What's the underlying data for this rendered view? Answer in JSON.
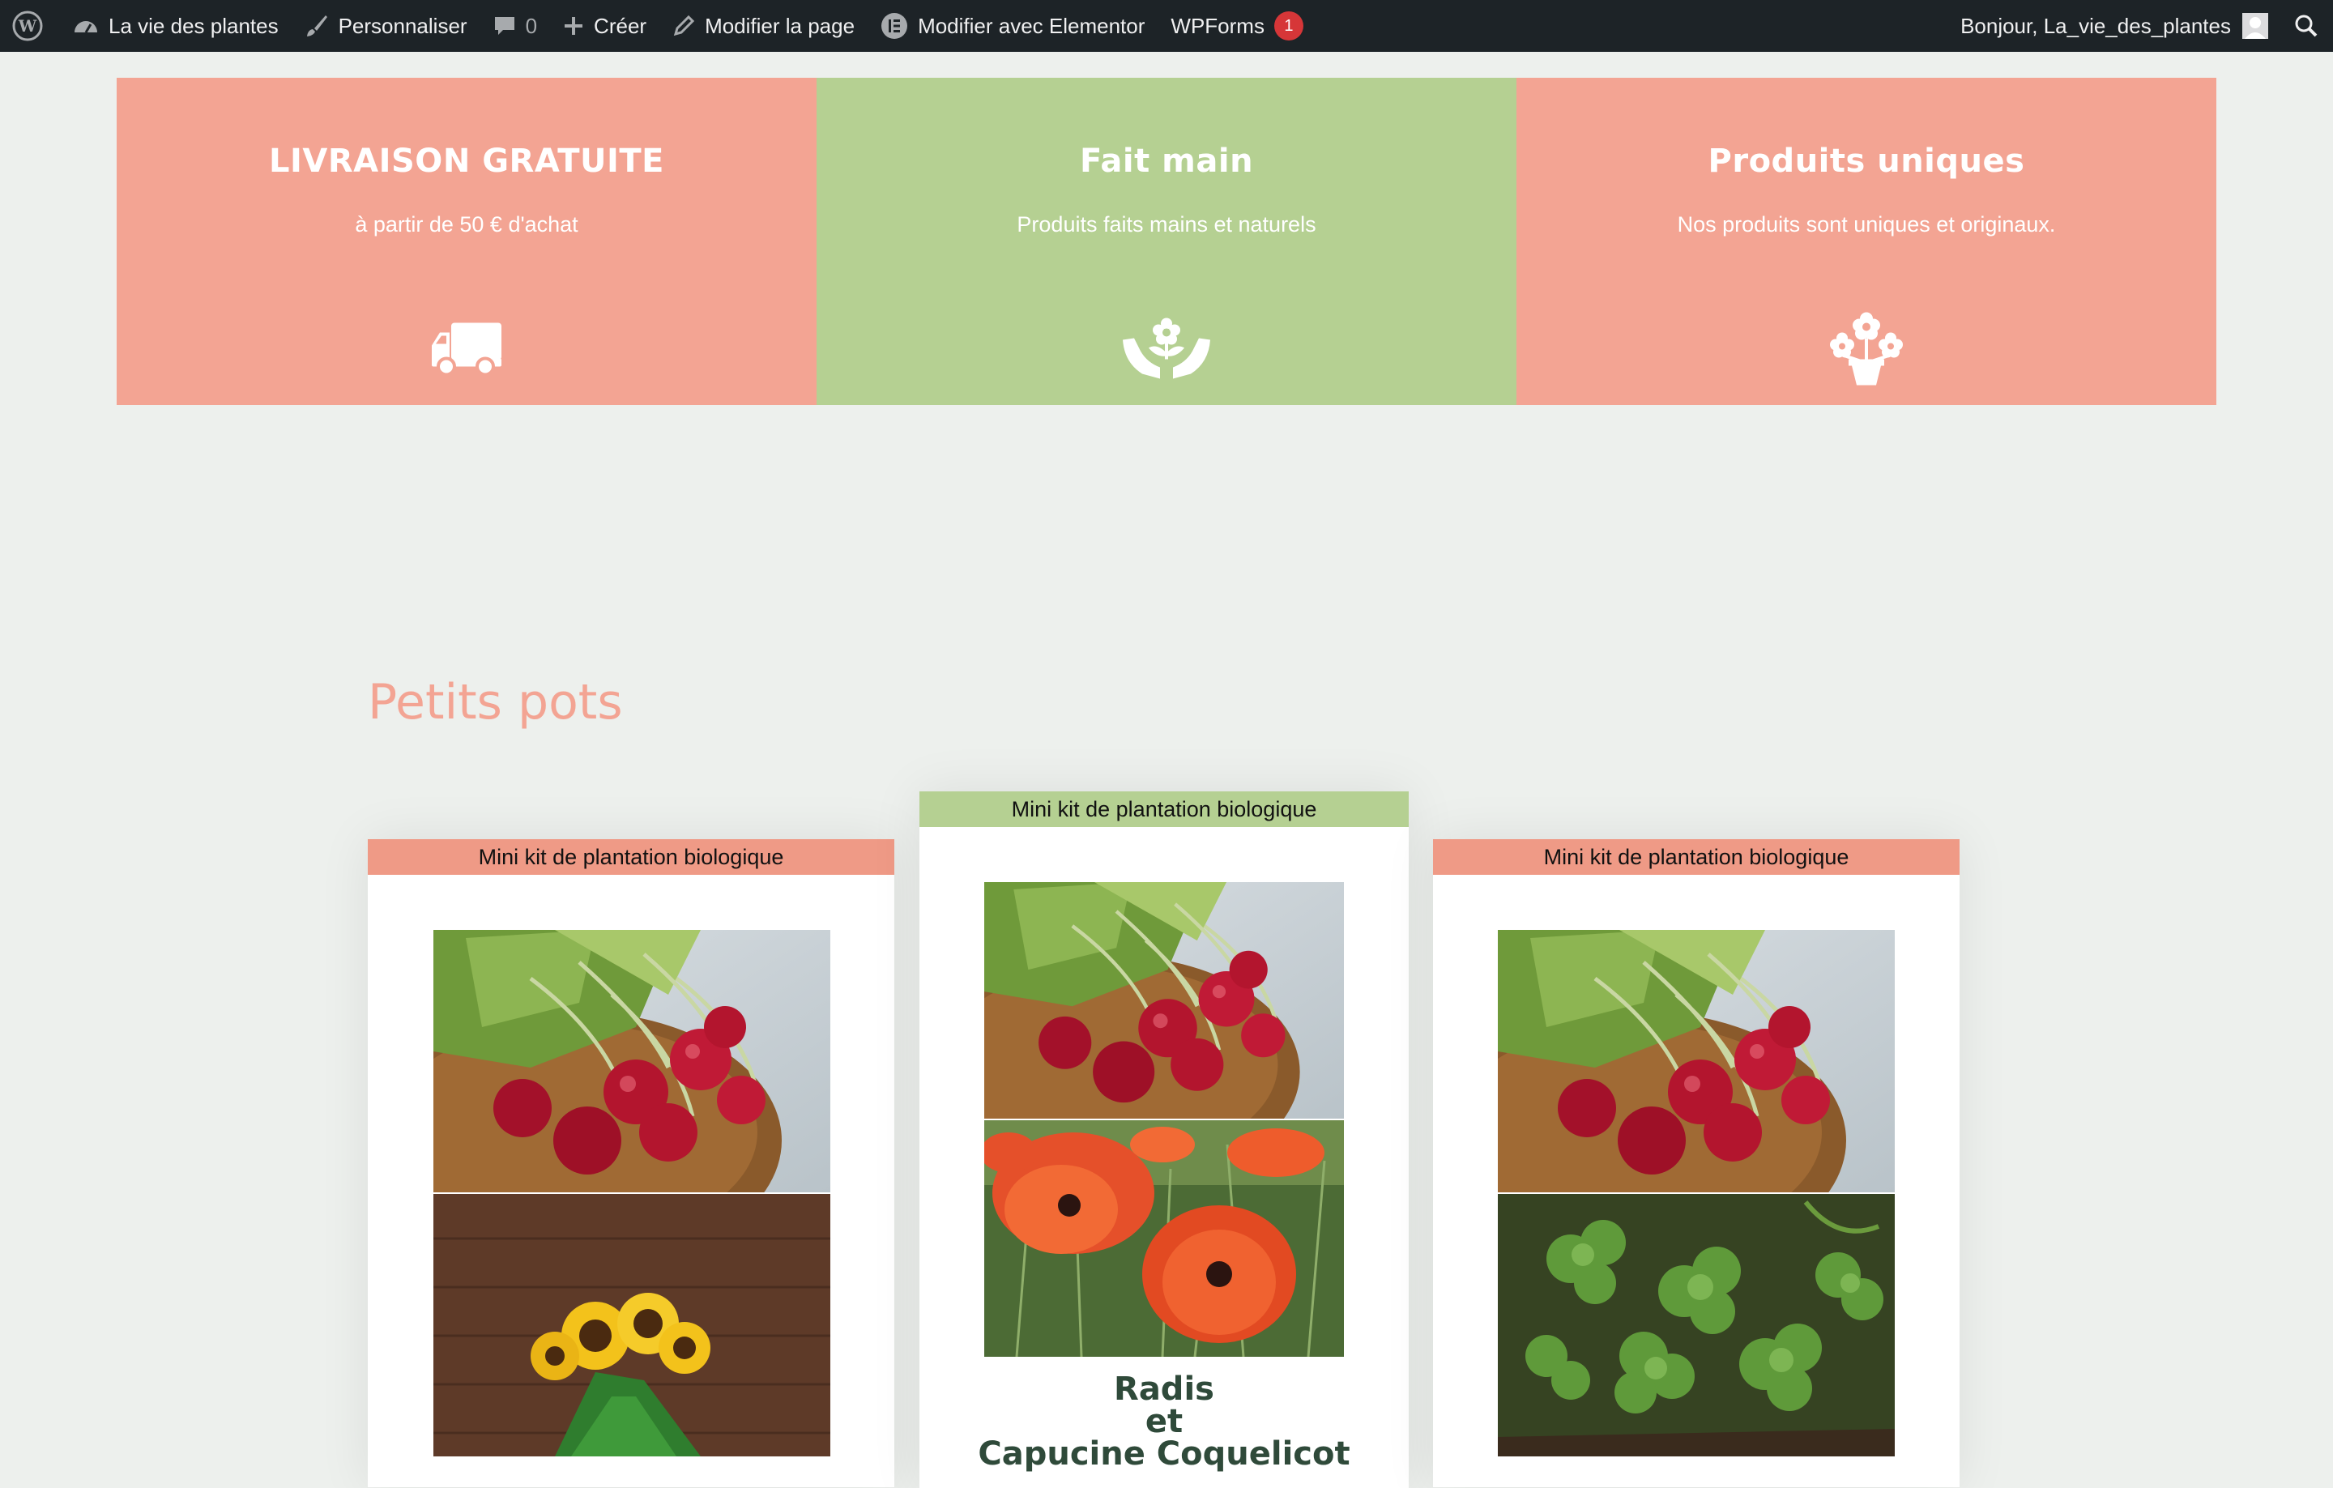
{
  "adminbar": {
    "site_name": "La vie des plantes",
    "customize": "Personnaliser",
    "comments_count": "0",
    "new": "Créer",
    "edit_page": "Modifier la page",
    "elementor": "Modifier avec Elementor",
    "wpforms": "WPForms",
    "wpforms_badge": "1",
    "greeting": "Bonjour, La_vie_des_plantes"
  },
  "features": [
    {
      "title": "LIVRAISON GRATUITE",
      "subtitle": "à partir de 50 € d'achat",
      "icon": "truck-icon",
      "color": "#f3a493"
    },
    {
      "title": "Fait main",
      "subtitle": "Produits faits mains et naturels",
      "icon": "hands-flower-icon",
      "color": "#b5d092"
    },
    {
      "title": "Produits uniques",
      "subtitle": "Nos produits sont uniques et originaux.",
      "icon": "flower-pot-icon",
      "color": "#f3a493"
    }
  ],
  "section": {
    "title": "Petits pots"
  },
  "products": [
    {
      "label": "Mini kit de plantation biologique",
      "images": [
        "radishes-photo",
        "sunflowers-photo"
      ]
    },
    {
      "label": "Mini kit de plantation biologique",
      "images": [
        "radishes-photo",
        "poppies-photo"
      ],
      "title_lines": [
        "Radis",
        "et",
        "Capucine Coquelicot"
      ]
    },
    {
      "label": "Mini kit de plantation biologique",
      "images": [
        "radishes-photo",
        "clover-photo"
      ]
    }
  ],
  "colors": {
    "salmon": "#f3a493",
    "green": "#b5d092",
    "admin_bar": "#1d2327",
    "background": "#edf0ed"
  }
}
